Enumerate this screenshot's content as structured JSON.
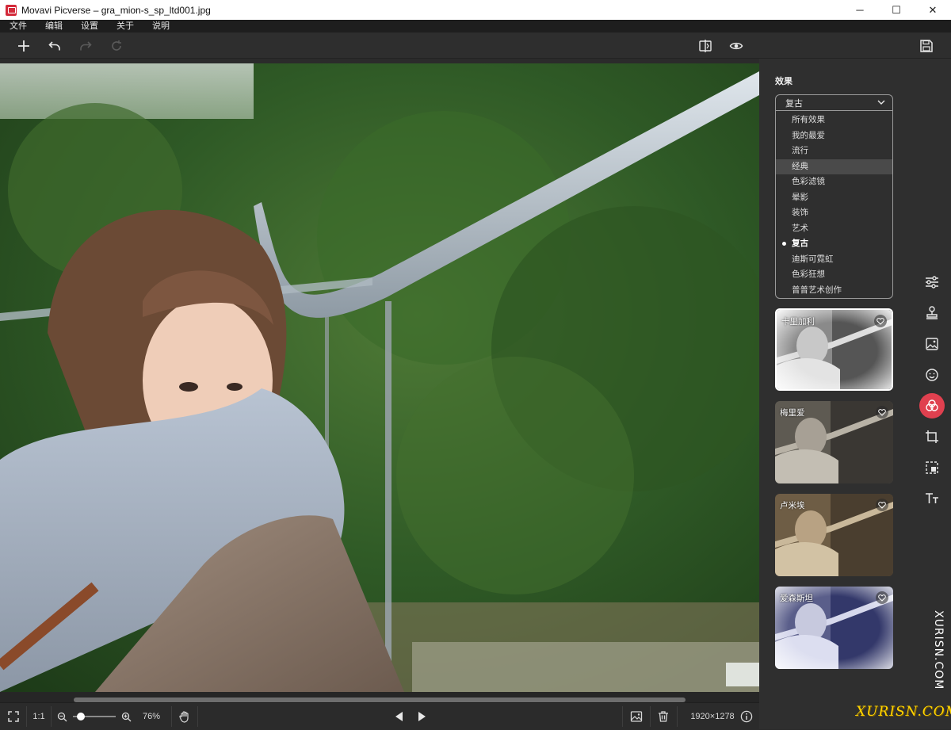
{
  "window": {
    "title": "Movavi Picverse – gra_mion-s_sp_ltd001.jpg",
    "minimize_glyph": "─",
    "maximize_glyph": "☐",
    "close_glyph": "✕"
  },
  "menu": {
    "items": [
      "文件",
      "编辑",
      "设置",
      "关于",
      "说明"
    ]
  },
  "toolbar": {
    "add_icon": "plus-icon",
    "undo_icon": "undo-icon",
    "redo_icon": "redo-icon",
    "reset_icon": "reset-icon",
    "compare_icon": "split-compare-icon",
    "preview_icon": "eye-icon",
    "save_icon": "save-icon"
  },
  "panel": {
    "title": "效果",
    "dropdown": {
      "selected": "复古",
      "options": [
        "所有效果",
        "我的最爱",
        "流行",
        "经典",
        "色彩滤镜",
        "晕影",
        "装饰",
        "艺术",
        "复古",
        "迪斯可霓虹",
        "色彩狂想",
        "普普艺术创作"
      ],
      "hover_index": 3,
      "selected_index": 8
    },
    "effects": [
      {
        "label": "卡里加利",
        "active": true,
        "tone": "bw-vignette"
      },
      {
        "label": "梅里爱",
        "active": false,
        "tone": "sepia-dark"
      },
      {
        "label": "卢米埃",
        "active": false,
        "tone": "sepia-warm"
      },
      {
        "label": "爱森斯坦",
        "active": false,
        "tone": "blue-ink"
      }
    ]
  },
  "side_tools": [
    {
      "name": "adjust",
      "icon": "sliders-icon",
      "active": false
    },
    {
      "name": "retouch",
      "icon": "stamp-icon",
      "active": false
    },
    {
      "name": "background",
      "icon": "image-icon",
      "active": false
    },
    {
      "name": "face",
      "icon": "face-icon",
      "active": false
    },
    {
      "name": "effects",
      "icon": "effects-icon",
      "active": true
    },
    {
      "name": "crop",
      "icon": "crop-icon",
      "active": false
    },
    {
      "name": "select",
      "icon": "selection-icon",
      "active": false
    },
    {
      "name": "text",
      "icon": "text-icon",
      "active": false
    }
  ],
  "statusbar": {
    "fullscreen_icon": "fullscreen-icon",
    "one_to_one": "1:1",
    "zoom_out_icon": "zoom-out-icon",
    "zoom_in_icon": "zoom-in-icon",
    "zoom_level": "76%",
    "zoom_fraction": 0.1,
    "hand_icon": "hand-icon",
    "prev_icon": "prev-icon",
    "next_icon": "next-icon",
    "gallery_icon": "gallery-icon",
    "delete_icon": "trash-icon",
    "dimensions": "1920×1278",
    "info_icon": "info-icon"
  },
  "watermark": {
    "vertical": "XURISN.COM",
    "horizontal": "XURISN.COM"
  },
  "colors": {
    "accent": "#e0404f",
    "panel_bg": "#2f2f2f",
    "toolbar_bg": "#2e2e2e"
  }
}
